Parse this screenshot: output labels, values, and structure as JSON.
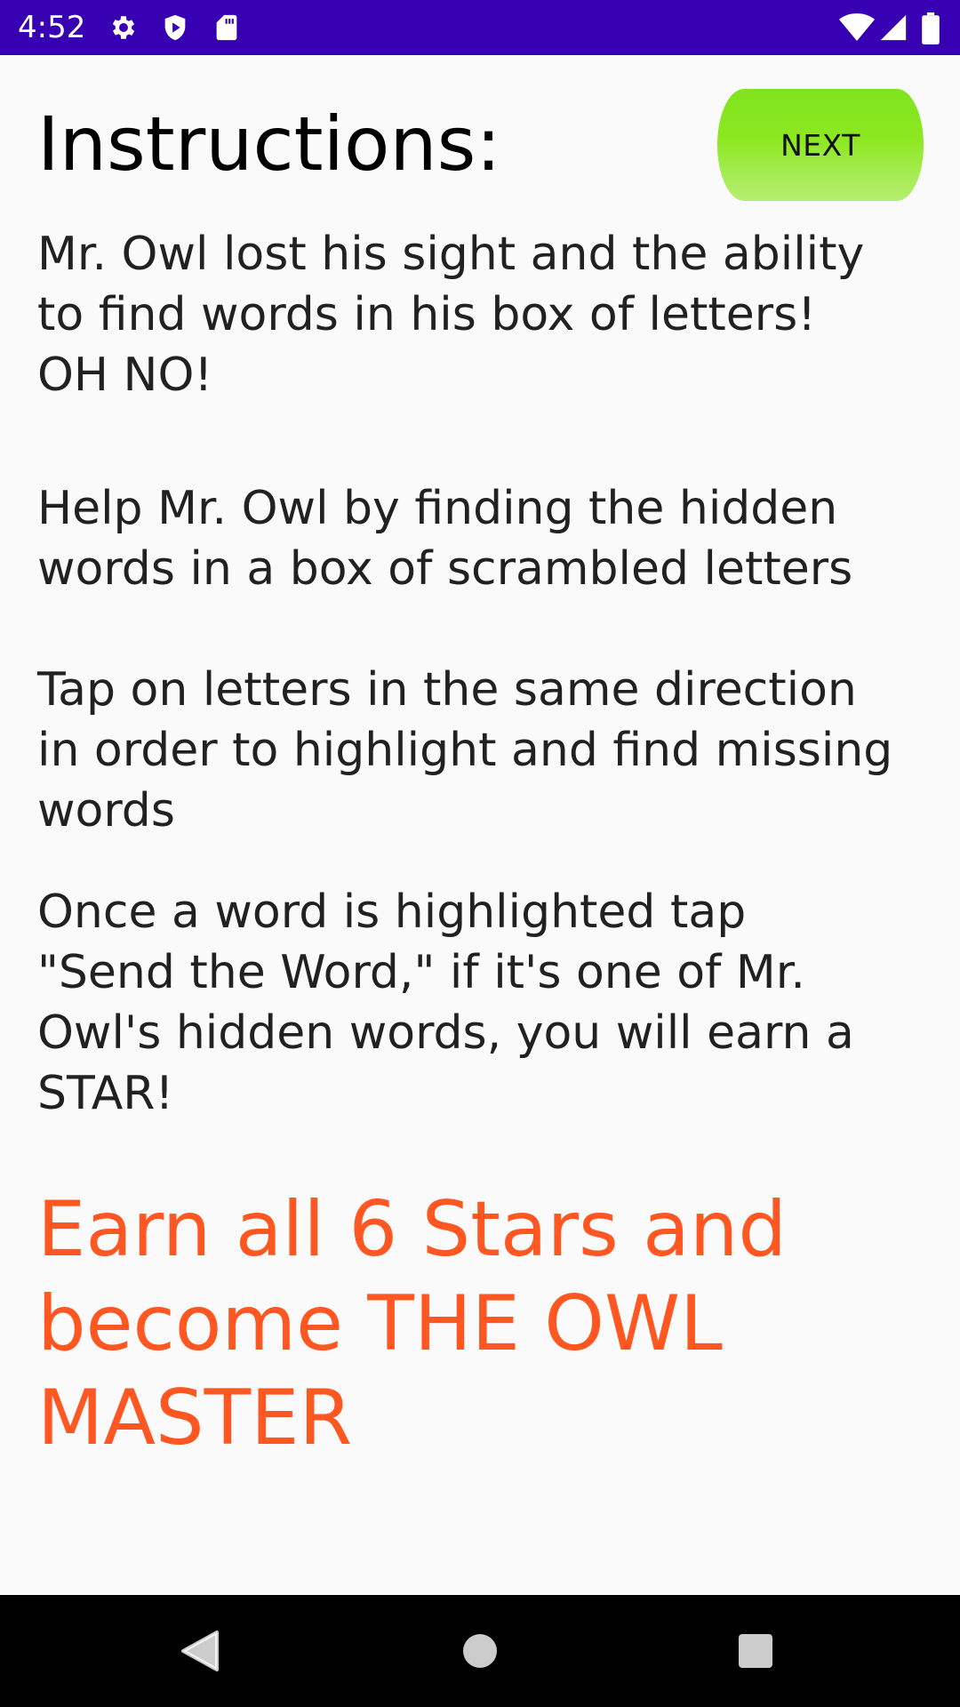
{
  "status_bar": {
    "time": "4:52",
    "left_icons": [
      "gear-icon",
      "shield-play-icon",
      "sd-card-icon"
    ],
    "right_icons": [
      "wifi-icon",
      "cellular-signal-icon",
      "battery-icon"
    ],
    "background_color": "#3700b3"
  },
  "header": {
    "title": "Instructions:",
    "next_label": "NEXT",
    "next_button_color": "#8ce820"
  },
  "instructions": {
    "para1": [
      "Mr. Owl lost his sight and the ability",
      "to find words in his box of letters!",
      "OH NO!"
    ],
    "para2": [
      "Help Mr. Owl by finding the hidden",
      "words in a box of scrambled letters"
    ],
    "para3": [
      "Tap on letters in the same direction",
      "in order to highlight and find missing",
      "words"
    ],
    "para4": [
      "Once a word is highlighted tap",
      "\"Send the Word,\" if it's one of Mr.",
      "Owl's hidden words, you will earn a",
      "STAR!"
    ]
  },
  "goal": {
    "lines": [
      "Earn all 6 Stars and",
      "become THE OWL",
      "MASTER"
    ],
    "color": "#ff5722"
  },
  "nav_bar": {
    "icons": [
      "back-icon",
      "home-icon",
      "recents-icon"
    ]
  }
}
